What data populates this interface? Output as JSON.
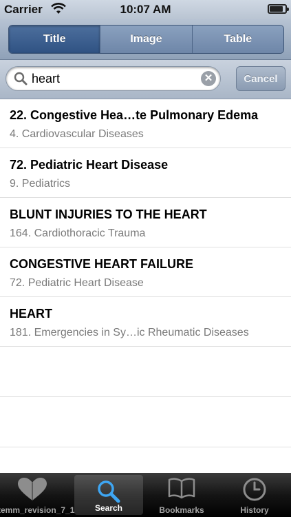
{
  "status": {
    "carrier": "Carrier",
    "time": "10:07 AM",
    "battery_level": 0.85
  },
  "segments": [
    {
      "label": "Title",
      "active": true
    },
    {
      "label": "Image",
      "active": false
    },
    {
      "label": "Table",
      "active": false
    }
  ],
  "search": {
    "value": "heart",
    "cancel_label": "Cancel"
  },
  "results": [
    {
      "title": "22. Congestive Hea…te Pulmonary Edema",
      "subtitle": "4. Cardiovascular Diseases"
    },
    {
      "title": "72. Pediatric Heart Disease",
      "subtitle": "9. Pediatrics"
    },
    {
      "title": "BLUNT INJURIES TO THE HEART",
      "subtitle": "164. Cardiothoracic Trauma"
    },
    {
      "title": "CONGESTIVE HEART FAILURE",
      "subtitle": "72. Pediatric Heart Disease"
    },
    {
      "title": "HEART",
      "subtitle": "181. Emergencies in Sy…ic Rheumatic Diseases"
    }
  ],
  "tabs": [
    {
      "label": "temm_revision_7_1",
      "icon": "heart-icon",
      "active": false
    },
    {
      "label": "Search",
      "icon": "search-icon",
      "active": true
    },
    {
      "label": "Bookmarks",
      "icon": "book-icon",
      "active": false
    },
    {
      "label": "History",
      "icon": "clock-icon",
      "active": false
    }
  ]
}
